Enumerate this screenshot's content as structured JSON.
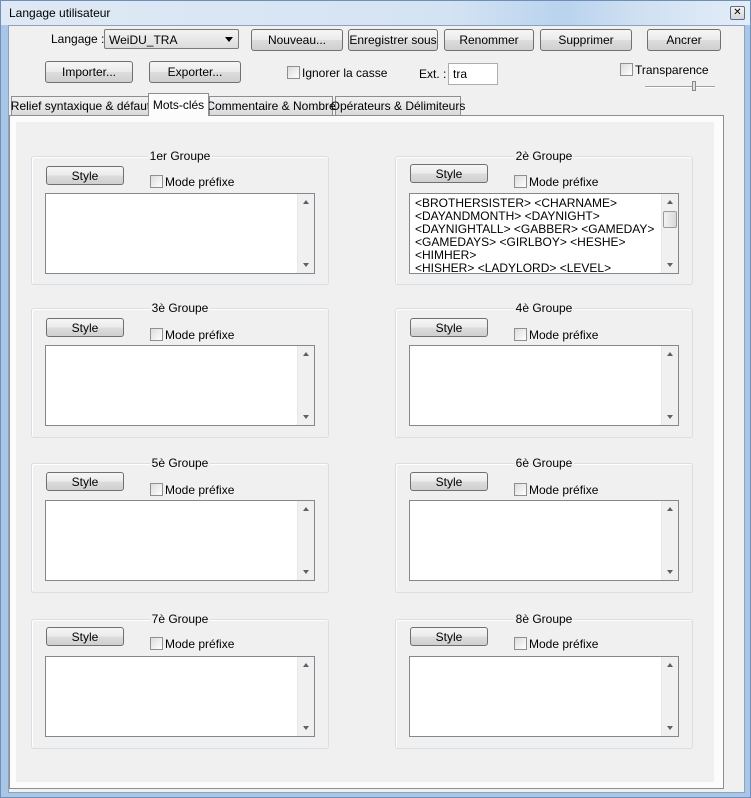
{
  "window": {
    "title": "Langage utilisateur",
    "close_glyph": "✕"
  },
  "toolbar": {
    "language_label": "Langage :",
    "language_value": "WeiDU_TRA",
    "new_label": "Nouveau...",
    "save_as_label": "Enregistrer sous",
    "rename_label": "Renommer",
    "delete_label": "Supprimer",
    "dock_label": "Ancrer",
    "import_label": "Importer...",
    "export_label": "Exporter...",
    "ignore_case_label": "Ignorer la casse",
    "ext_label": "Ext. :",
    "ext_value": "tra",
    "transparency_label": "Transparence"
  },
  "tabs": [
    {
      "label": "Relief syntaxique & défaut"
    },
    {
      "label": "Mots-clés",
      "active": true
    },
    {
      "label": "Commentaire & Nombre"
    },
    {
      "label": "Opérateurs & Délimiteurs"
    }
  ],
  "groups": [
    {
      "title": "1er Groupe",
      "style_label": "Style",
      "prefix_label": "Mode préfixe",
      "lines": []
    },
    {
      "title": "2è Groupe",
      "style_label": "Style",
      "prefix_label": "Mode préfixe",
      "lines": [
        "<BROTHERSISTER> <CHARNAME>",
        "<DAYANDMONTH> <DAYNIGHT>",
        "<DAYNIGHTALL> <GABBER> <GAMEDAY>",
        "<GAMEDAYS> <GIRLBOY> <HESHE> <HIMHER>",
        "<HISHER> <LADYLORD> <LEVEL>"
      ]
    },
    {
      "title": "3è Groupe",
      "style_label": "Style",
      "prefix_label": "Mode préfixe",
      "lines": []
    },
    {
      "title": "4è Groupe",
      "style_label": "Style",
      "prefix_label": "Mode préfixe",
      "lines": []
    },
    {
      "title": "5è Groupe",
      "style_label": "Style",
      "prefix_label": "Mode préfixe",
      "lines": []
    },
    {
      "title": "6è Groupe",
      "style_label": "Style",
      "prefix_label": "Mode préfixe",
      "lines": []
    },
    {
      "title": "7è Groupe",
      "style_label": "Style",
      "prefix_label": "Mode préfixe",
      "lines": []
    },
    {
      "title": "8è Groupe",
      "style_label": "Style",
      "prefix_label": "Mode préfixe",
      "lines": []
    }
  ]
}
